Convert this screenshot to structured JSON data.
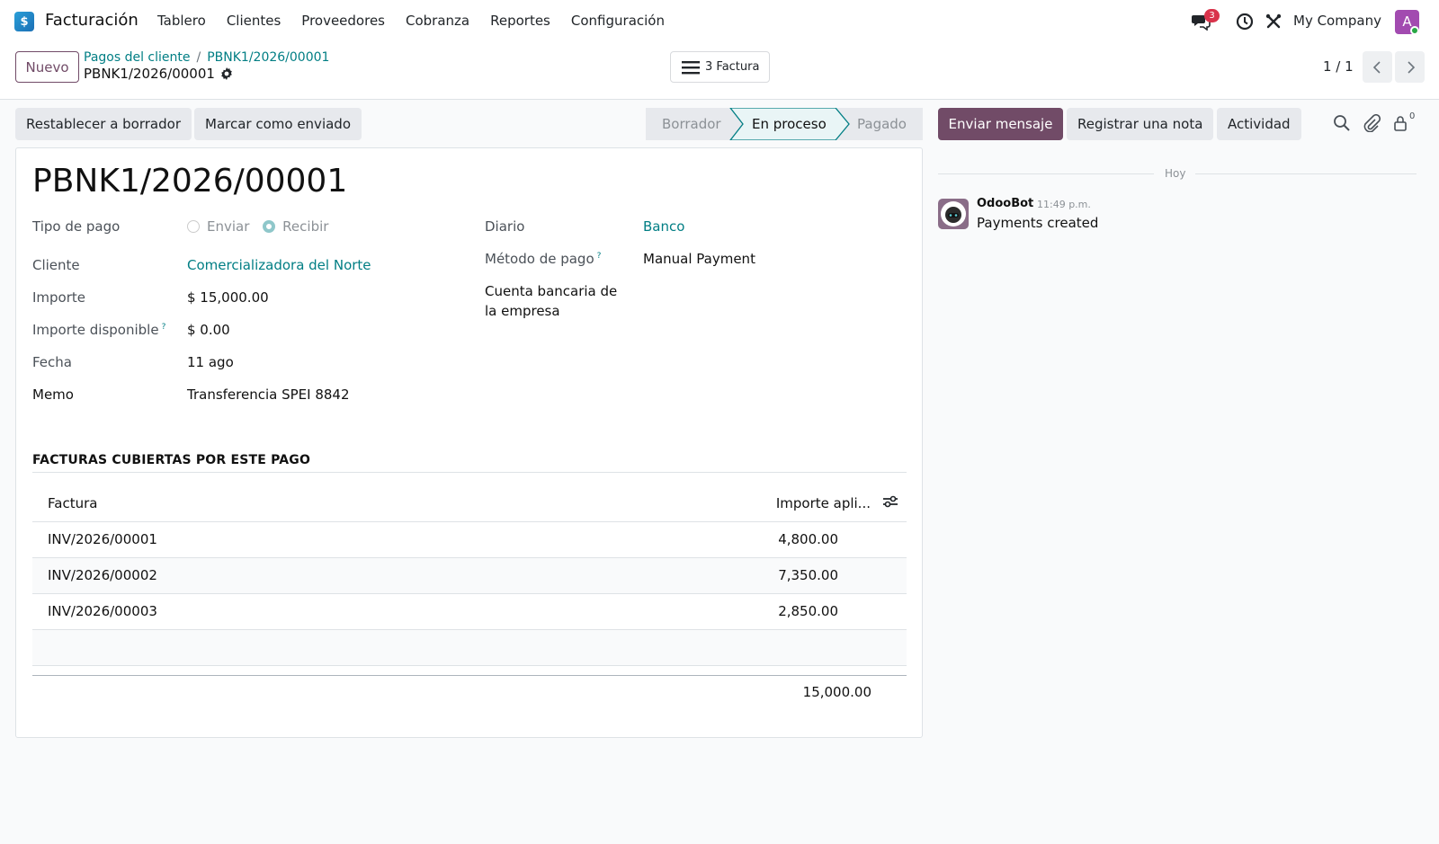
{
  "navbar": {
    "app_name": "Facturación",
    "menu": [
      "Tablero",
      "Clientes",
      "Proveedores",
      "Cobranza",
      "Reportes",
      "Configuración"
    ],
    "chat_badge": "3",
    "company": "My Company",
    "avatar_letter": "A"
  },
  "control": {
    "new_label": "Nuevo",
    "breadcrumb_parent": "Pagos del cliente",
    "breadcrumb_current": "PBNK1/2026/00001",
    "record_title": "PBNK1/2026/00001",
    "smart_button": "3 Factura",
    "pager": "1 / 1"
  },
  "actions": {
    "reset_draft": "Restablecer a borrador",
    "mark_sent": "Marcar como enviado",
    "stages": [
      "Borrador",
      "En proceso",
      "Pagado"
    ],
    "active_stage": "En proceso",
    "send_message": "Enviar mensaje",
    "log_note": "Registrar una nota",
    "activity": "Actividad",
    "follower_count": "0"
  },
  "form": {
    "name": "PBNK1/2026/00001",
    "payment_type_label": "Tipo de pago",
    "payment_type_options": [
      "Enviar",
      "Recibir"
    ],
    "payment_type_selected": "Recibir",
    "customer_label": "Cliente",
    "customer": "Comercializadora del Norte",
    "amount_label": "Importe",
    "amount": "$ 15,000.00",
    "available_label": "Importe disponible",
    "available": "$ 0.00",
    "date_label": "Fecha",
    "date": "11 ago",
    "memo_label": "Memo",
    "memo": "Transferencia SPEI 8842",
    "journal_label": "Diario",
    "journal": "Banco",
    "method_label": "Método de pago",
    "method": "Manual Payment",
    "bank_label_1": "Cuenta bancaria de",
    "bank_label_2": "la empresa",
    "help_mark": "?"
  },
  "invoices": {
    "section_title": "FACTURAS CUBIERTAS POR ESTE PAGO",
    "col_invoice": "Factura",
    "col_amount": "Importe apli...",
    "rows": [
      {
        "invoice": "INV/2026/00001",
        "amount": "4,800.00"
      },
      {
        "invoice": "INV/2026/00002",
        "amount": "7,350.00"
      },
      {
        "invoice": "INV/2026/00003",
        "amount": "2,850.00"
      }
    ],
    "total": "15,000.00"
  },
  "chatter": {
    "day": "Hoy",
    "author": "OdooBot",
    "time": "11:49 p.m.",
    "body": "Payments created"
  },
  "colors": {
    "brand": "#714b67",
    "link": "#017e84",
    "badge": "#d9334b"
  },
  "icons": [
    "app-logo-icon",
    "chat-icon",
    "clock-icon",
    "tools-icon",
    "gear-icon",
    "list-icon",
    "chevron-left-icon",
    "chevron-right-icon",
    "search-icon",
    "paperclip-icon",
    "follower-lock-icon",
    "column-settings-icon"
  ]
}
